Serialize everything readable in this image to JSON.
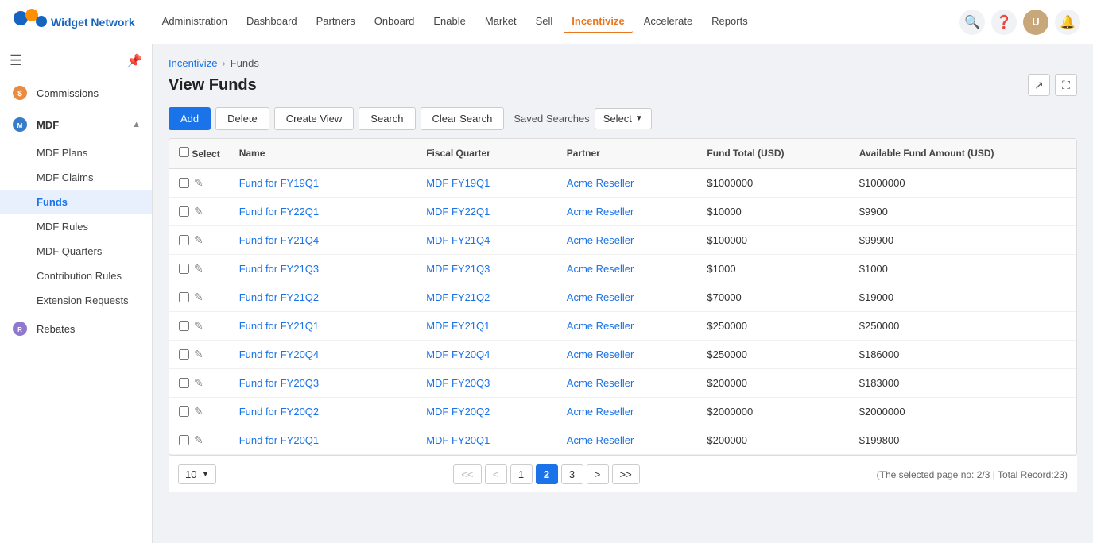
{
  "app": {
    "title": "Widget Network"
  },
  "topnav": {
    "links": [
      {
        "label": "Administration",
        "active": false
      },
      {
        "label": "Dashboard",
        "active": false
      },
      {
        "label": "Partners",
        "active": false
      },
      {
        "label": "Onboard",
        "active": false
      },
      {
        "label": "Enable",
        "active": false
      },
      {
        "label": "Market",
        "active": false
      },
      {
        "label": "Sell",
        "active": false
      },
      {
        "label": "Incentivize",
        "active": true
      },
      {
        "label": "Accelerate",
        "active": false
      },
      {
        "label": "Reports",
        "active": false
      }
    ]
  },
  "sidebar": {
    "commissions_label": "Commissions",
    "mdf_label": "MDF",
    "mdf_sub_items": [
      {
        "label": "MDF Plans",
        "active": false
      },
      {
        "label": "MDF Claims",
        "active": false
      },
      {
        "label": "Funds",
        "active": true
      },
      {
        "label": "MDF Rules",
        "active": false
      },
      {
        "label": "MDF Quarters",
        "active": false
      },
      {
        "label": "Contribution Rules",
        "active": false
      },
      {
        "label": "Extension Requests",
        "active": false
      }
    ],
    "rebates_label": "Rebates"
  },
  "breadcrumb": {
    "parent": "Incentivize",
    "current": "Funds"
  },
  "page": {
    "title": "View Funds"
  },
  "toolbar": {
    "add_label": "Add",
    "delete_label": "Delete",
    "create_view_label": "Create View",
    "search_label": "Search",
    "clear_search_label": "Clear Search",
    "saved_searches_label": "Saved Searches",
    "select_label": "Select"
  },
  "table": {
    "columns": [
      "Select",
      "Name",
      "Fiscal Quarter",
      "Partner",
      "Fund Total (USD)",
      "Available Fund Amount (USD)"
    ],
    "rows": [
      {
        "name": "Fund for FY19Q1",
        "fiscal_quarter": "MDF FY19Q1",
        "partner": "Acme Reseller",
        "fund_total": "$1000000",
        "available": "$1000000"
      },
      {
        "name": "Fund for FY22Q1",
        "fiscal_quarter": "MDF FY22Q1",
        "partner": "Acme Reseller",
        "fund_total": "$10000",
        "available": "$9900"
      },
      {
        "name": "Fund for FY21Q4",
        "fiscal_quarter": "MDF FY21Q4",
        "partner": "Acme Reseller",
        "fund_total": "$100000",
        "available": "$99900"
      },
      {
        "name": "Fund for FY21Q3",
        "fiscal_quarter": "MDF FY21Q3",
        "partner": "Acme Reseller",
        "fund_total": "$1000",
        "available": "$1000"
      },
      {
        "name": "Fund for FY21Q2",
        "fiscal_quarter": "MDF FY21Q2",
        "partner": "Acme Reseller",
        "fund_total": "$70000",
        "available": "$19000"
      },
      {
        "name": "Fund for FY21Q1",
        "fiscal_quarter": "MDF FY21Q1",
        "partner": "Acme Reseller",
        "fund_total": "$250000",
        "available": "$250000"
      },
      {
        "name": "Fund for FY20Q4",
        "fiscal_quarter": "MDF FY20Q4",
        "partner": "Acme Reseller",
        "fund_total": "$250000",
        "available": "$186000"
      },
      {
        "name": "Fund for FY20Q3",
        "fiscal_quarter": "MDF FY20Q3",
        "partner": "Acme Reseller",
        "fund_total": "$200000",
        "available": "$183000"
      },
      {
        "name": "Fund for FY20Q2",
        "fiscal_quarter": "MDF FY20Q2",
        "partner": "Acme Reseller",
        "fund_total": "$2000000",
        "available": "$2000000"
      },
      {
        "name": "Fund for FY20Q1",
        "fiscal_quarter": "MDF FY20Q1",
        "partner": "Acme Reseller",
        "fund_total": "$200000",
        "available": "$199800"
      }
    ]
  },
  "pagination": {
    "page_size": "10",
    "pages": [
      "1",
      "2",
      "3"
    ],
    "current_page": "2",
    "info": "(The selected page no: 2/3 | Total Record:23)"
  }
}
